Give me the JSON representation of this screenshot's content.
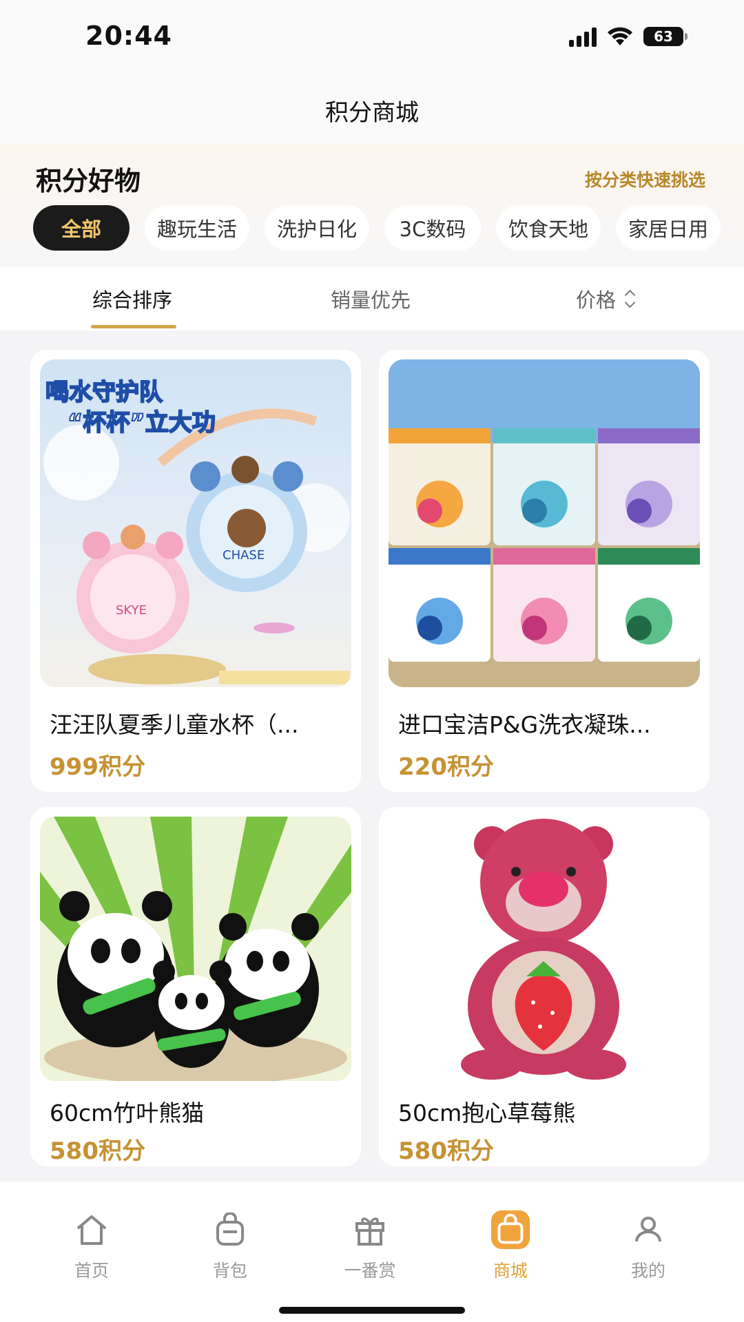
{
  "status_bar": {
    "time": "20:44",
    "battery": "63"
  },
  "header": {
    "title": "积分商城"
  },
  "category": {
    "title": "积分好物",
    "quick_pick": "按分类快速挑选",
    "chips": [
      "全部",
      "趣玩生活",
      "洗护日化",
      "3C数码",
      "饮食天地",
      "家居日用"
    ]
  },
  "sort": {
    "tabs": [
      "综合排序",
      "销量优先",
      "价格"
    ]
  },
  "products": [
    {
      "name": "汪汪队夏季儿童水杯（...",
      "price": "999积分",
      "image_text_1": "喝水守护队",
      "image_text_2": "“杯杯”立大功"
    },
    {
      "name": "进口宝洁P&G洗衣凝珠...",
      "price": "220积分"
    },
    {
      "name": "60cm竹叶熊猫",
      "price": "580积分"
    },
    {
      "name": "50cm抱心草莓熊",
      "price": "580积分"
    }
  ],
  "bottom_nav": {
    "items": [
      "首页",
      "背包",
      "一番赏",
      "商城",
      "我的"
    ],
    "active": "商城",
    "accent": "#e0a13a"
  },
  "colors": {
    "gold": "#c69233",
    "chip_active_bg": "#1b1b1b",
    "chip_active_text": "#f5c66a"
  }
}
